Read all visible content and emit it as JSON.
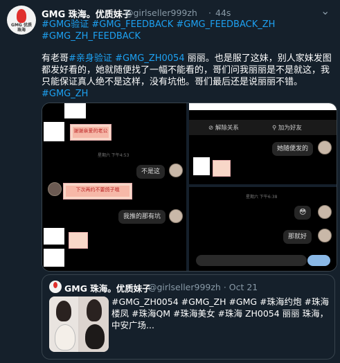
{
  "tweet": {
    "avatar_text": "GMG 优质\n珠海",
    "display_name": "GMG 珠海。优质妹子",
    "handle": "@girlseller999zh",
    "separator": "·",
    "time": "44s",
    "more_icon": "more-icon",
    "hashtags": "#GMG验证 #GMG_FEEDBACK #GMG_FEEDBACK_ZH #GMG_ZH_FEEDBACK",
    "body_prefix": "有老哥",
    "body_link1": "#亲身验证",
    "body_space": " ",
    "body_link2": "#GMG_ZH0054",
    "body_text": " 丽丽。也是服了这妹，别人家妹发图都发好看的，她就随便找了一幅不能看的，哥们问我丽丽是不是就这，我只能保证真人绝不是这样，没有坑他。哥们最后还是说丽丽不错。",
    "body_link3": "#GMG_ZH"
  },
  "media": {
    "left": {
      "sticker1_text": "谢谢亲爱的老公",
      "stamp1": "星期六 下午4:53",
      "msg1": "不是这",
      "sticker2_text": "下次再约不要鸽子哦",
      "msg2": "我推的那有坑"
    },
    "right": {
      "action_unfriend": "⊘ 解除关系",
      "action_add": "⚲ 加为好友",
      "msg_top": "她随便发的",
      "stamp2": "星期六 下午6:38",
      "emoji": "😳",
      "msg_bottom": "那就好"
    }
  },
  "quoted": {
    "display_name": "GMG 珠海。优质妹子",
    "handle": "@girlseller999zh · Oct 21",
    "text": "#GMG_ZH0054 #GMG_ZH #GMG #珠海约炮 #珠海楼凤 #珠海QM #珠海美女 #珠海 ZH0054 丽丽 珠海，中安广场..."
  },
  "colors": {
    "background": "#15202b",
    "link": "#1da1f2",
    "muted": "#8899a6"
  }
}
